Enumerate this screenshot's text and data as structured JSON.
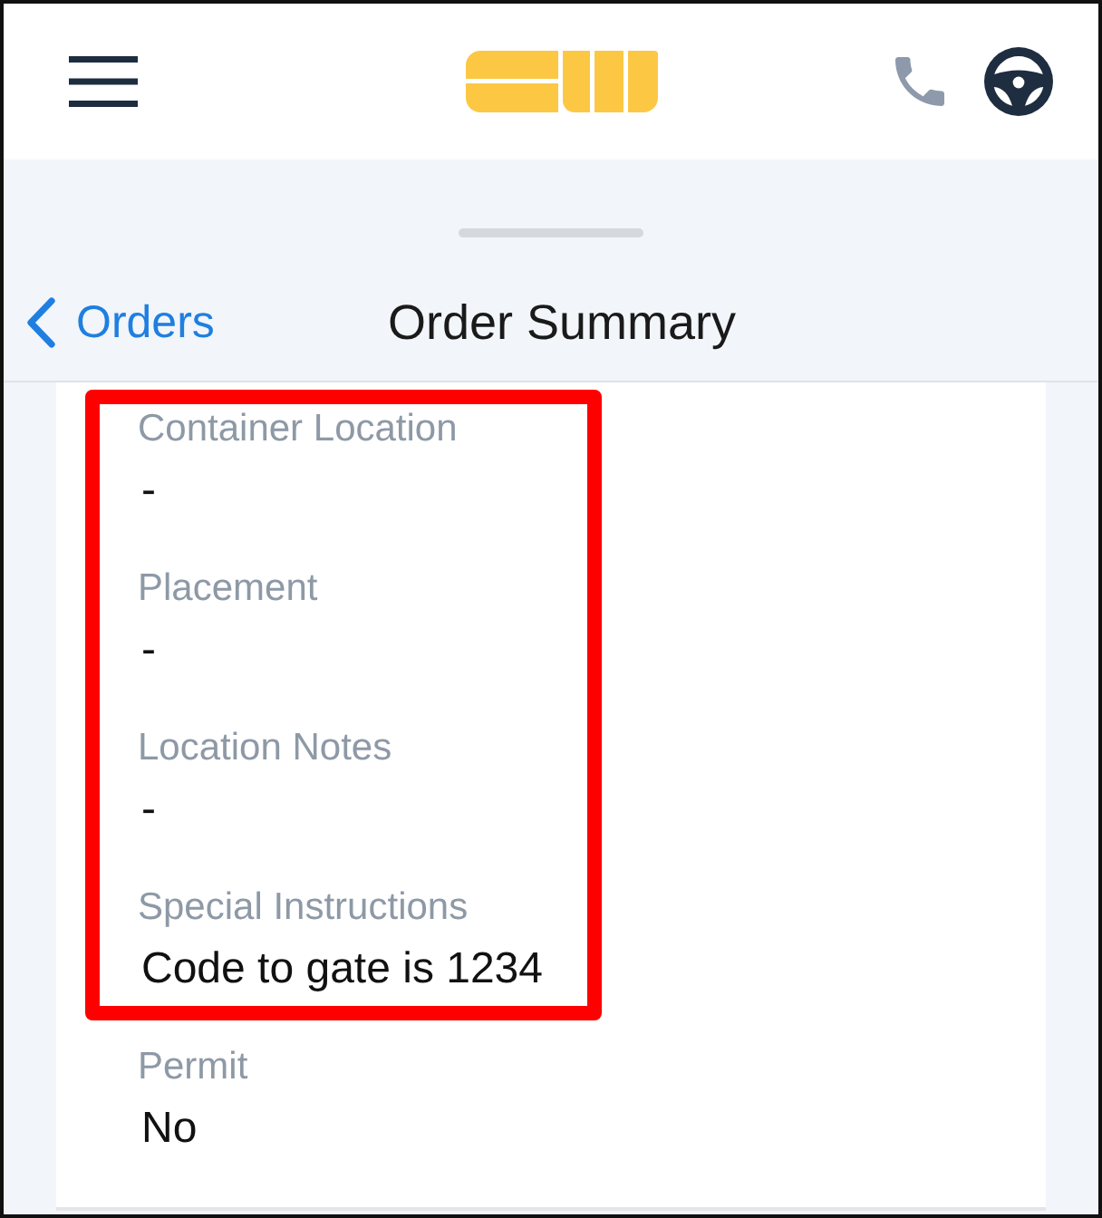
{
  "nav": {
    "back_label": "Orders",
    "title": "Order Summary"
  },
  "fields": [
    {
      "label": "Container Location",
      "value": "-",
      "highlighted": true
    },
    {
      "label": "Placement",
      "value": "-",
      "highlighted": true
    },
    {
      "label": "Location Notes",
      "value": "-",
      "highlighted": true
    },
    {
      "label": "Special Instructions",
      "value": "Code to gate is 1234",
      "highlighted": true
    },
    {
      "label": "Permit",
      "value": "No",
      "highlighted": false
    }
  ]
}
